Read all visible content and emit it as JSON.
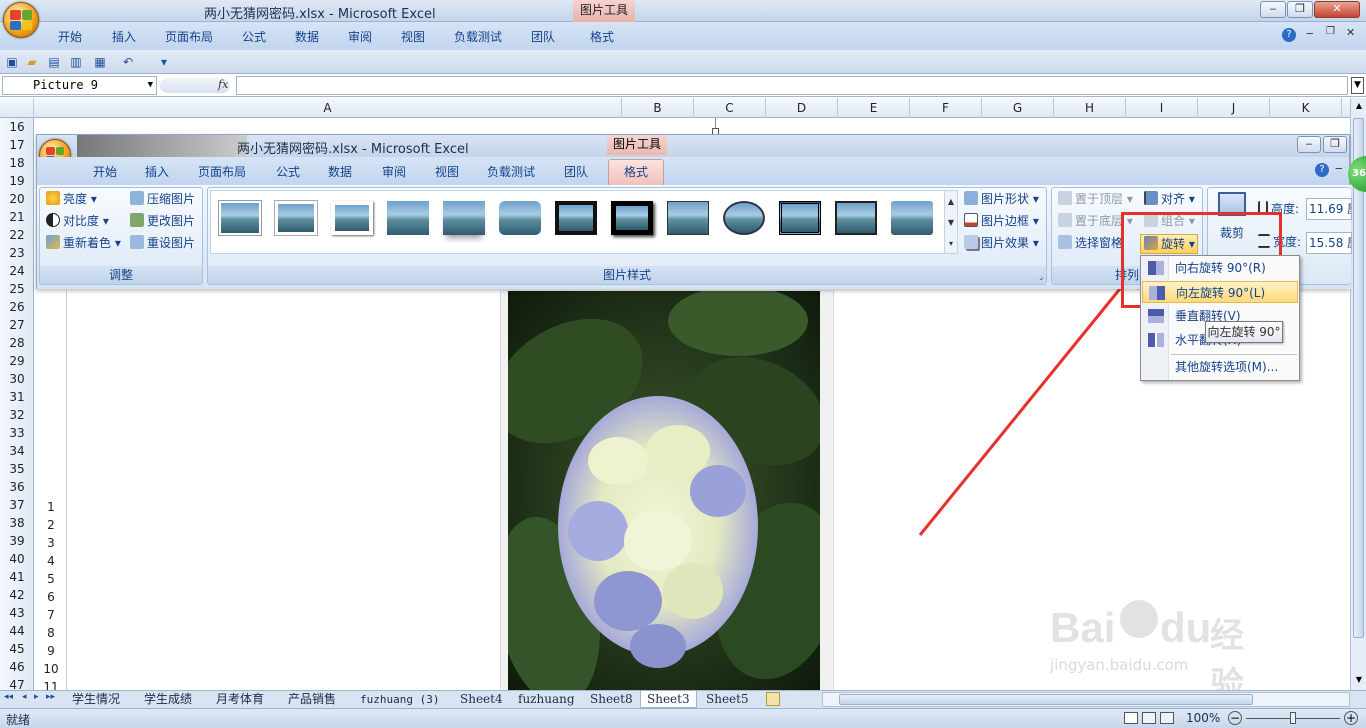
{
  "app": {
    "title": "两小无猜网密码.xlsx - Microsoft Excel",
    "contextual_tab_group": "图片工具"
  },
  "ribbon_tabs": [
    "开始",
    "插入",
    "页面布局",
    "公式",
    "数据",
    "审阅",
    "视图",
    "负载测试",
    "团队",
    "格式"
  ],
  "name_box": "Picture 9",
  "formula_fx": "fx",
  "columns": [
    "A",
    "B",
    "C",
    "D",
    "E",
    "F",
    "G",
    "H",
    "I",
    "J",
    "K"
  ],
  "rows_outer": [
    "16",
    "17",
    "18",
    "19",
    "20",
    "21",
    "22",
    "23",
    "24",
    "25",
    "26",
    "27",
    "28",
    "29",
    "30",
    "31",
    "32",
    "33",
    "34",
    "35",
    "36",
    "37",
    "38",
    "39",
    "40",
    "41",
    "42",
    "43",
    "44",
    "45",
    "46",
    "47"
  ],
  "rows_inner": [
    "1",
    "2",
    "3",
    "4",
    "5",
    "6",
    "7",
    "8",
    "9",
    "10",
    "11"
  ],
  "inner_window": {
    "title": "两小无猜网密码.xlsx - Microsoft Excel",
    "contextual_tab_group": "图片工具",
    "tabs": [
      "开始",
      "插入",
      "页面布局",
      "公式",
      "数据",
      "审阅",
      "视图",
      "负载测试",
      "团队",
      "格式"
    ],
    "active_tab": "格式"
  },
  "adjust_group": {
    "label": "调整",
    "brightness": "亮度",
    "contrast": "对比度",
    "recolor": "重新着色",
    "compress": "压缩图片",
    "change": "更改图片",
    "reset": "重设图片"
  },
  "styles_group": {
    "label": "图片样式",
    "shape": "图片形状",
    "border": "图片边框",
    "effects": "图片效果"
  },
  "arrange_group": {
    "label": "排列",
    "bring_front": "置于顶层",
    "send_back": "置于底层",
    "selection_pane": "选择窗格",
    "align": "对齐",
    "group": "组合",
    "rotate": "旋转"
  },
  "size_group": {
    "crop": "裁剪",
    "height_label": "高度:",
    "height_value": "11.69 厘",
    "width_label": "宽度:",
    "width_value": "15.58 厘"
  },
  "rotate_menu": {
    "items": [
      "向右旋转 90°(R)",
      "向左旋转 90°(L)",
      "垂直翻转(V)",
      "水平翻转(H)",
      "其他旋转选项(M)..."
    ],
    "highlighted": "向左旋转 90°(L)"
  },
  "tooltip": "向左旋转 90°",
  "sheet_tabs": [
    "学生情况",
    "学生成绩",
    "月考体育",
    "产品销售",
    "fuzhuang (3)",
    "Sheet4",
    "fuzhuang",
    "Sheet8",
    "Sheet3",
    "Sheet5"
  ],
  "status": {
    "ready": "就绪",
    "zoom": "100%"
  },
  "watermark": {
    "brand": "Bai",
    "brand2": "du",
    "product": "经验",
    "url": "jingyan.baidu.com"
  },
  "badge": "36",
  "colors": {
    "accent_red": "#e8302a",
    "ribbon_text": "#15428b",
    "highlight": "#ffd97a"
  }
}
